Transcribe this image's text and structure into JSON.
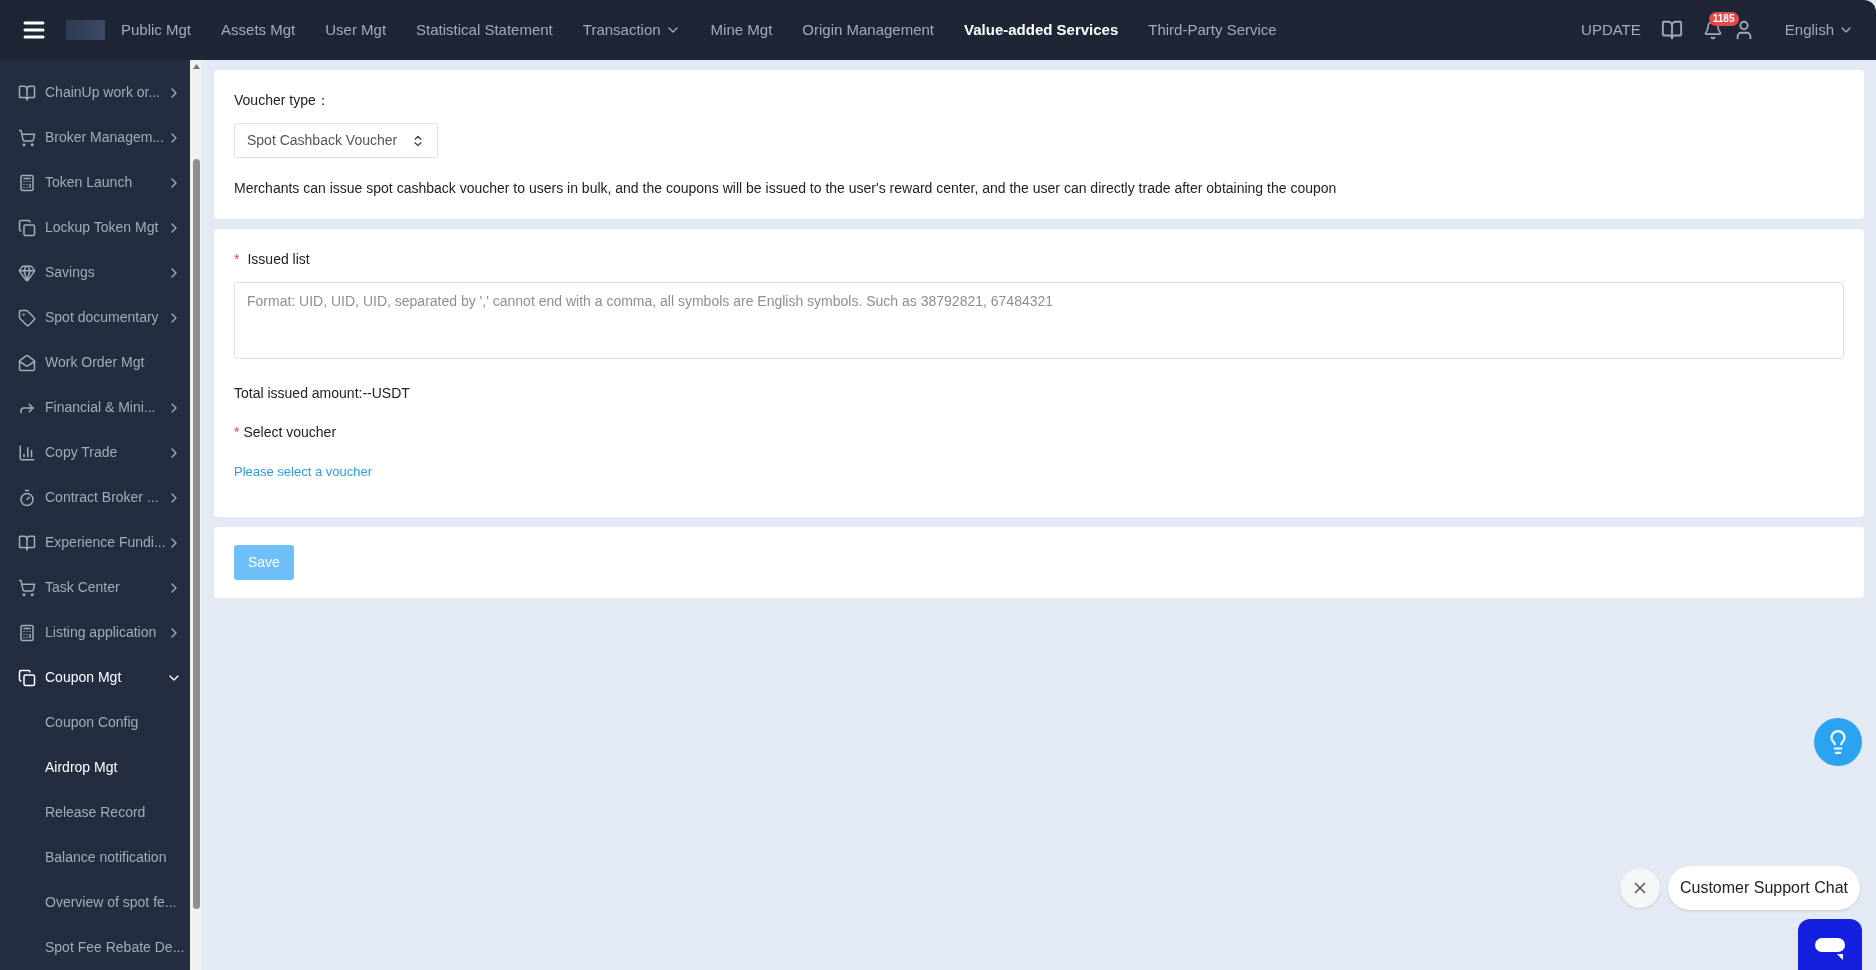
{
  "top_nav": {
    "items": [
      {
        "label": "Public Mgt",
        "selected": false,
        "dropdown": false
      },
      {
        "label": "Assets Mgt",
        "selected": false,
        "dropdown": false
      },
      {
        "label": "User Mgt",
        "selected": false,
        "dropdown": false
      },
      {
        "label": "Statistical Statement",
        "selected": false,
        "dropdown": false
      },
      {
        "label": "Transaction",
        "selected": false,
        "dropdown": true
      },
      {
        "label": "Mine Mgt",
        "selected": false,
        "dropdown": false
      },
      {
        "label": "Origin Management",
        "selected": false,
        "dropdown": false
      },
      {
        "label": "Value-added Services",
        "selected": true,
        "dropdown": false
      },
      {
        "label": "Third-Party Service",
        "selected": false,
        "dropdown": false
      }
    ],
    "update": "UPDATE",
    "notification_count": "1185",
    "language": "English"
  },
  "sidebar": {
    "items": [
      {
        "label": "ChainUp work or...",
        "has_submenu": true,
        "expanded": false
      },
      {
        "label": "Broker Managem...",
        "has_submenu": true,
        "expanded": false
      },
      {
        "label": "Token Launch",
        "has_submenu": true,
        "expanded": false
      },
      {
        "label": "Lockup Token Mgt",
        "has_submenu": true,
        "expanded": false
      },
      {
        "label": "Savings",
        "has_submenu": true,
        "expanded": false
      },
      {
        "label": "Spot documentary",
        "has_submenu": true,
        "expanded": false
      },
      {
        "label": "Work Order Mgt",
        "has_submenu": false,
        "expanded": false
      },
      {
        "label": "Financial & Mini...",
        "has_submenu": true,
        "expanded": false
      },
      {
        "label": "Copy Trade",
        "has_submenu": true,
        "expanded": false
      },
      {
        "label": "Contract Broker ...",
        "has_submenu": true,
        "expanded": false
      },
      {
        "label": "Experience Fundi...",
        "has_submenu": true,
        "expanded": false
      },
      {
        "label": "Task Center",
        "has_submenu": true,
        "expanded": false
      },
      {
        "label": "Listing application",
        "has_submenu": true,
        "expanded": false
      },
      {
        "label": "Coupon Mgt",
        "has_submenu": true,
        "expanded": true,
        "children": [
          {
            "label": "Coupon Config",
            "selected": false
          },
          {
            "label": "Airdrop Mgt",
            "selected": true
          },
          {
            "label": "Release Record",
            "selected": false
          },
          {
            "label": "Balance notification",
            "selected": false
          },
          {
            "label": "Overview of spot fe...",
            "selected": false
          },
          {
            "label": "Spot Fee Rebate De...",
            "selected": false
          }
        ]
      }
    ]
  },
  "voucher_card": {
    "label": "Voucher type：",
    "select_value": "Spot Cashback Voucher",
    "description": "Merchants can issue spot cashback voucher to users in bulk, and the coupons will be issued to the user's reward center, and the user can directly trade after obtaining the coupon"
  },
  "issue_card": {
    "required_mark": "*",
    "issued_list_label": "Issued list",
    "issued_list_placeholder": "Format: UID, UID, UID, separated by ',' cannot end with a comma, all symbols are English symbols. Such as 38792821, 67484321",
    "total": "Total issued amount:--USDT",
    "select_voucher_label": "Select voucher",
    "select_voucher_link": "Please select a voucher"
  },
  "save_button": {
    "label": "Save",
    "disabled": true
  },
  "support": {
    "chat_label": "Customer Support Chat"
  }
}
